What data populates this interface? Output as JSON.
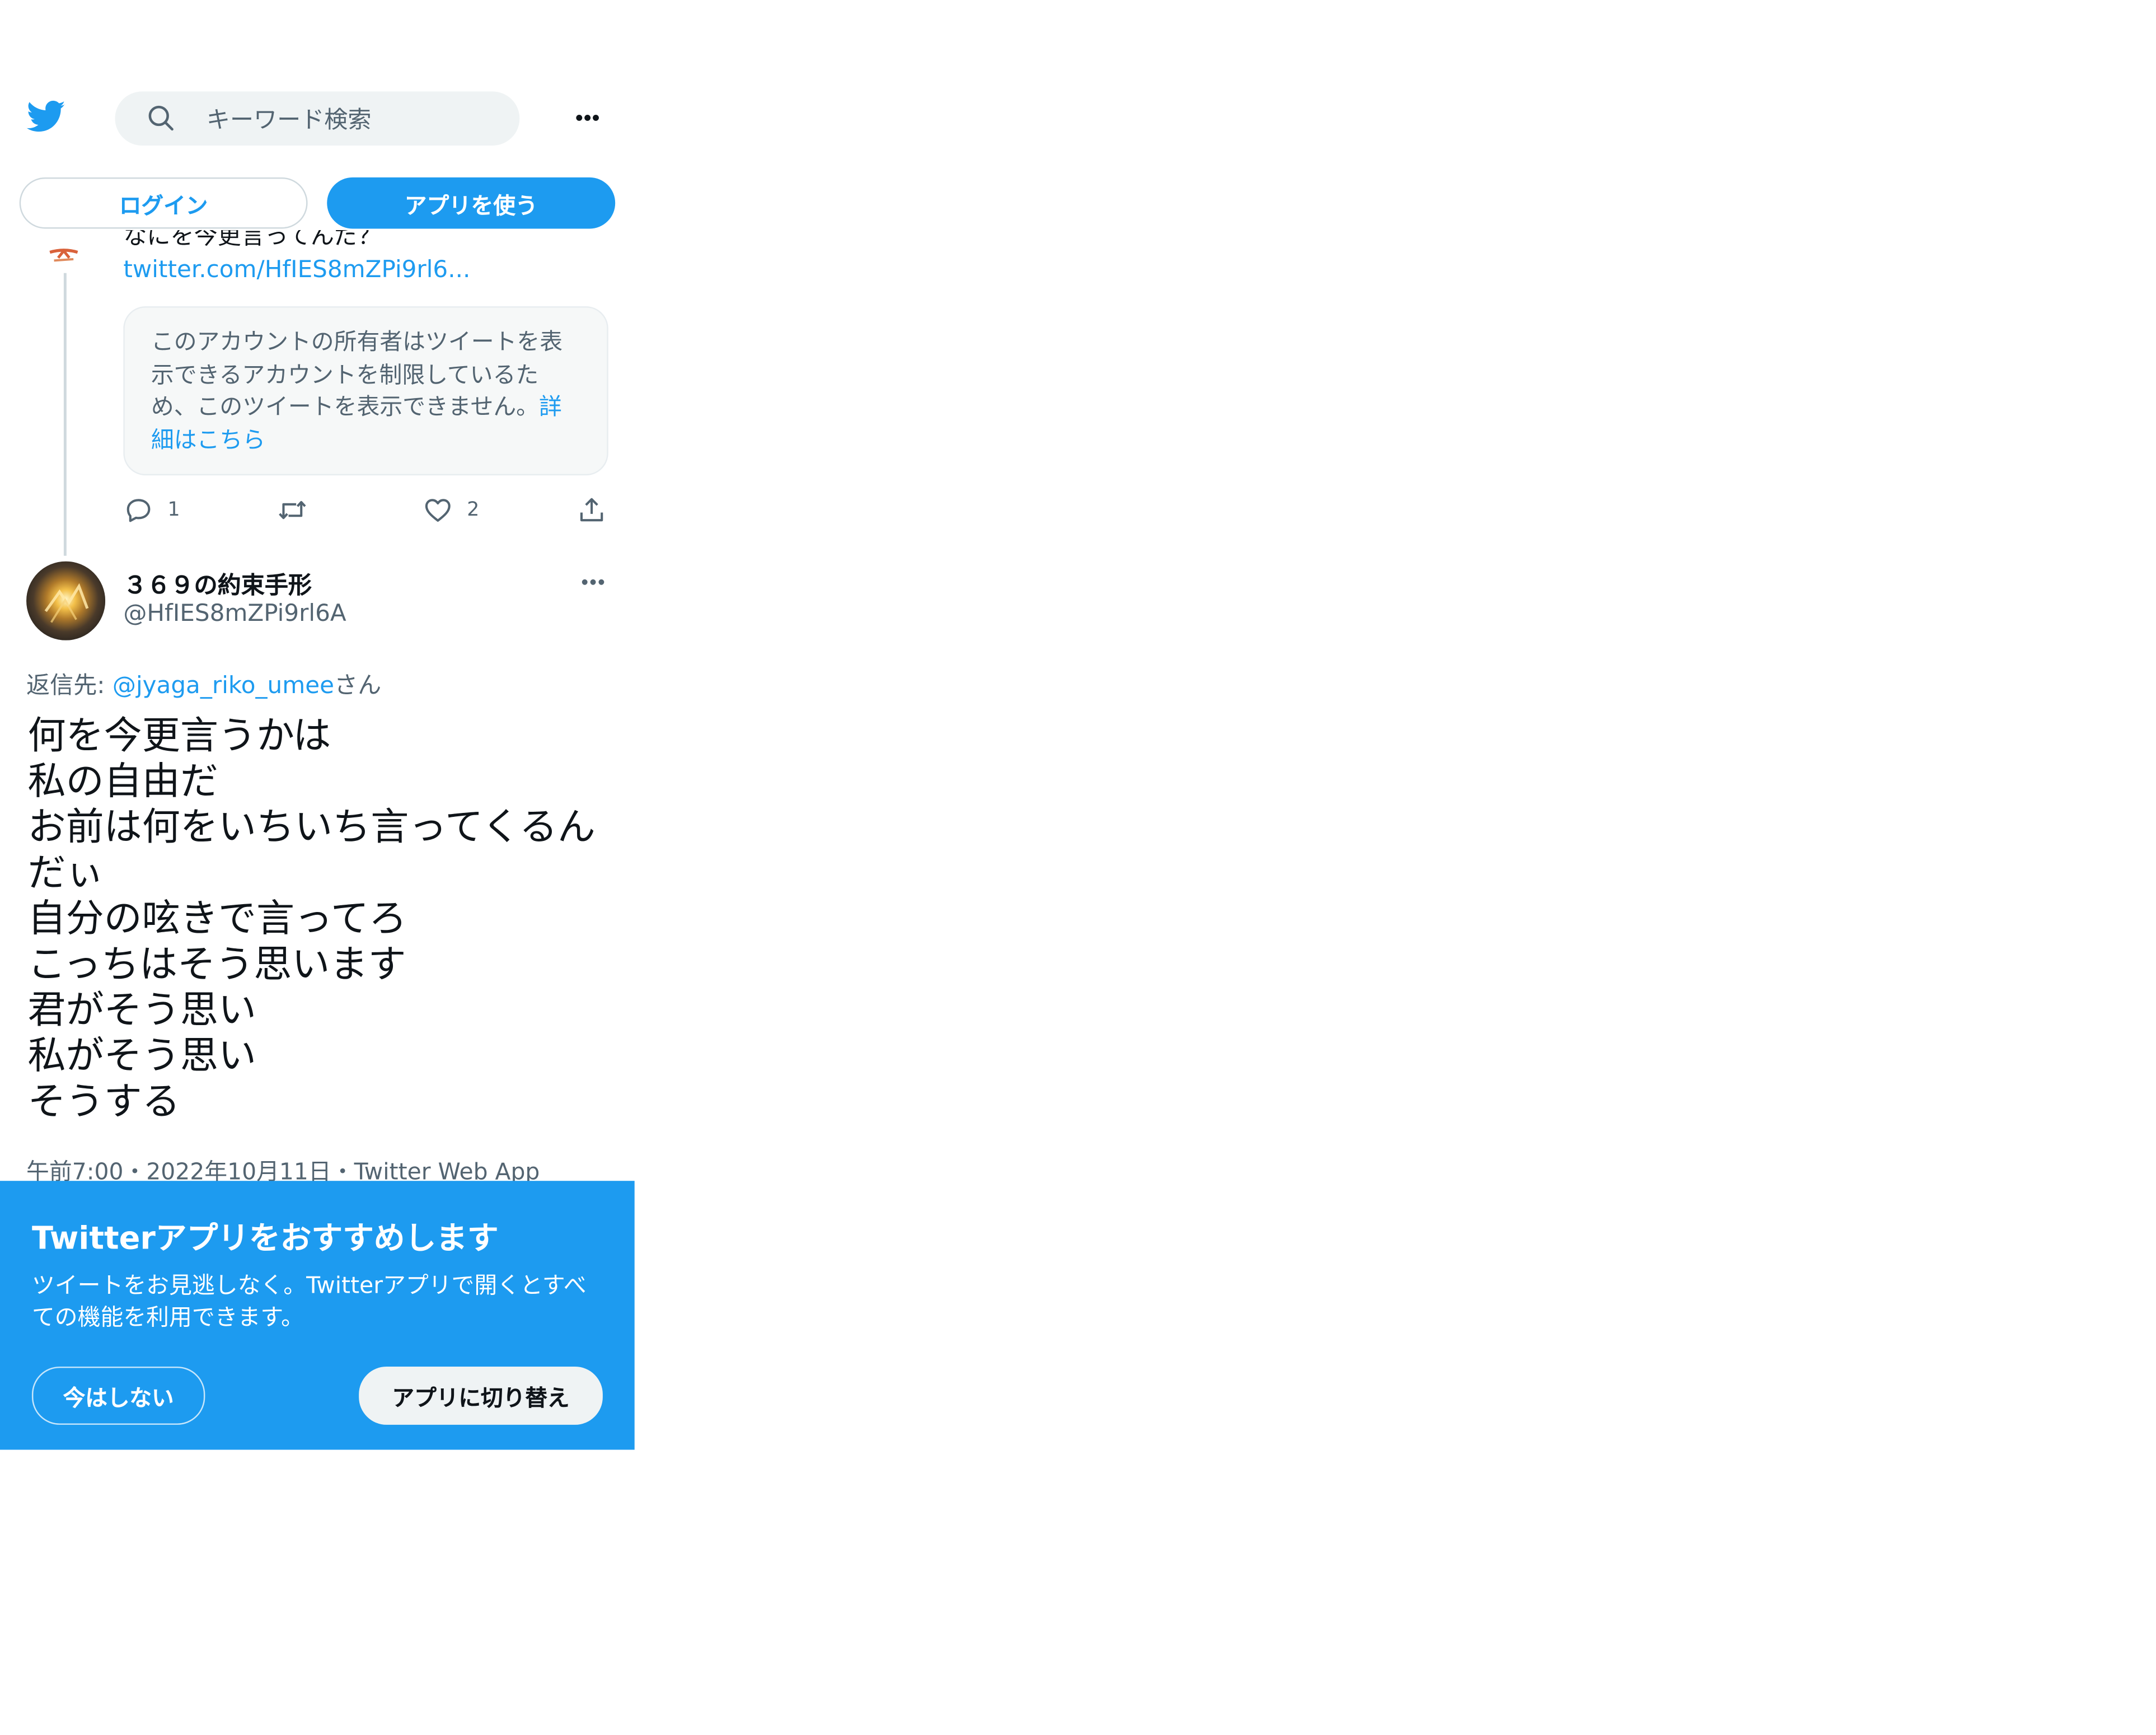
{
  "header": {
    "search": {
      "placeholder": "キーワード検索"
    },
    "login_label": "ログイン",
    "use_app_label": "アプリを使う"
  },
  "previous_tweet": {
    "text": "なにを今更言ってんだ？",
    "link": "twitter.com/HfIES8mZPi9rl6...",
    "restricted_notice": "このアカウントの所有者はツイートを表示できるアカウントを制限しているため、このツイートを表示できません。",
    "restricted_link": "詳細はこちら",
    "reply_count": "1",
    "retweet_count": "",
    "like_count": "2"
  },
  "tweet": {
    "display_name": "３６９の約束手形",
    "handle": "@HfIES8mZPi9rl6A",
    "reply_prefix": "返信先: ",
    "reply_user": "@jyaga_riko_umee",
    "reply_suffix": "さん",
    "text_lines": [
      "何を今更言うかは",
      "私の自由だ",
      "お前は何をいちいち言ってくるん",
      "だぃ",
      "自分の呟きで言ってろ",
      "こっちはそう思います",
      "君がそう思い",
      "私がそう思い",
      "そうする"
    ],
    "meta": "午前7:00・2022年10月11日・Twitter Web App"
  },
  "app_banner": {
    "title": "Twitterアプリをおすすめします",
    "description": "ツイートをお見逃しなく。Twitterアプリで開くとすべての機能を利用できます。",
    "not_now_label": "今はしない",
    "switch_label": "アプリに切り替え"
  },
  "colors": {
    "brand": "#1d9bf0",
    "text_primary": "#0f1419",
    "text_secondary": "#536471",
    "search_bg": "#eff3f4"
  },
  "icons": [
    "twitter-logo",
    "search-icon",
    "more-icon",
    "reply-icon",
    "retweet-icon",
    "like-icon",
    "share-icon"
  ]
}
